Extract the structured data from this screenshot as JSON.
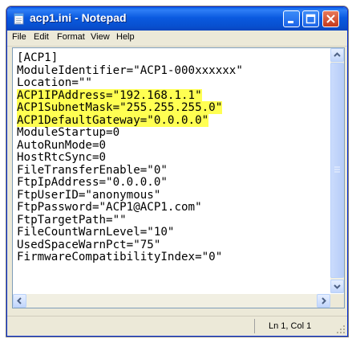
{
  "window": {
    "title": "acp1.ini - Notepad"
  },
  "menu": [
    "File",
    "Edit",
    "Format",
    "View",
    "Help"
  ],
  "editor": {
    "lines": [
      "[ACP1]",
      "ModuleIdentifier=\"ACP1-000xxxxxx\"",
      "Location=\"\"",
      "ACP1IPAddress=\"192.168.1.1\"",
      "ACP1SubnetMask=\"255.255.255.0\"",
      "ACP1DefaultGateway=\"0.0.0.0\"",
      "ModuleStartup=0",
      "AutoRunMode=0",
      "HostRtcSync=0",
      "FileTransferEnable=\"0\"",
      "FtpIpAddress=\"0.0.0.0\"",
      "FtpUserID=\"anonymous\"",
      "FtpPassword=\"ACP1@ACP1.com\"",
      "FtpTargetPath=\"\"",
      "FileCountWarnLevel=\"10\"",
      "UsedSpaceWarnPct=\"75\"",
      "FirmwareCompatibilityIndex=\"0\""
    ],
    "highlighted_lines": [
      3,
      4,
      5
    ],
    "highlight_color": "#ffff52"
  },
  "status": {
    "position": "Ln 1, Col 1"
  },
  "icons": {
    "app": "notepad-icon",
    "minimize": "minimize-icon",
    "maximize": "maximize-icon",
    "close": "close-icon"
  },
  "colors": {
    "titlebar": "#0a5ae0",
    "close_button": "#c4391c"
  }
}
